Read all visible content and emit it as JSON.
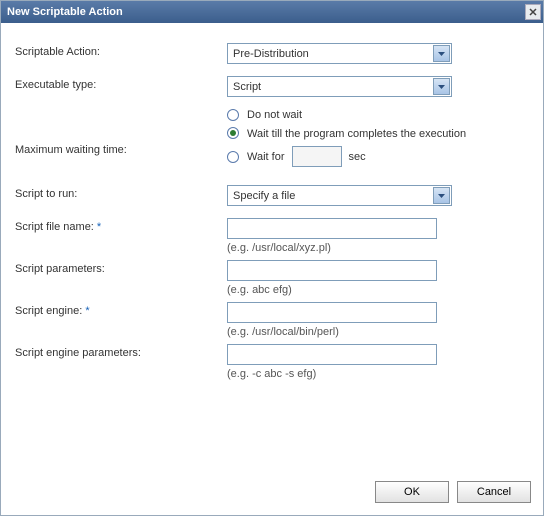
{
  "dialog": {
    "title": "New Scriptable Action"
  },
  "labels": {
    "scriptable_action": "Scriptable Action:",
    "executable_type": "Executable type:",
    "max_wait": "Maximum waiting time:",
    "script_to_run": "Script to run:",
    "script_file_name": "Script file name: ",
    "script_parameters": "Script parameters:",
    "script_engine": "Script engine: ",
    "script_engine_parameters": "Script engine parameters:",
    "required_mark": "*"
  },
  "values": {
    "scriptable_action": "Pre-Distribution",
    "executable_type": "Script",
    "script_to_run": "Specify a file",
    "wait_for_value": "",
    "script_file_name": "",
    "script_parameters": "",
    "script_engine": "",
    "script_engine_parameters": ""
  },
  "radios": {
    "do_not_wait": "Do not wait",
    "wait_complete": "Wait till the program completes the execution",
    "wait_for": "Wait for",
    "sec": "sec",
    "selected": "wait_complete"
  },
  "hints": {
    "script_file_name": "(e.g. /usr/local/xyz.pl)",
    "script_parameters": "(e.g. abc efg)",
    "script_engine": "(e.g. /usr/local/bin/perl)",
    "script_engine_parameters": "(e.g. -c abc -s efg)"
  },
  "buttons": {
    "ok": "OK",
    "cancel": "Cancel"
  }
}
